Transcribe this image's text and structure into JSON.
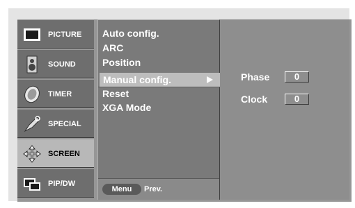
{
  "sidebar": {
    "items": [
      {
        "label": "PICTURE",
        "icon": "picture-icon"
      },
      {
        "label": "SOUND",
        "icon": "speaker-icon"
      },
      {
        "label": "TIMER",
        "icon": "clock-icon"
      },
      {
        "label": "SPECIAL",
        "icon": "pen-icon"
      },
      {
        "label": "SCREEN",
        "icon": "move-arrows-icon",
        "active": true
      },
      {
        "label": "PIP/DW",
        "icon": "pip-icon"
      }
    ]
  },
  "menu": {
    "items": [
      "Auto config.",
      "ARC",
      "Position",
      "Manual config.",
      "Reset",
      "XGA Mode"
    ],
    "selected": "Manual config."
  },
  "footer": {
    "menu_button": "Menu",
    "prev_label": "Prev."
  },
  "manual_config": {
    "params": [
      {
        "label": "Phase",
        "value": "0"
      },
      {
        "label": "Clock",
        "value": "0"
      }
    ]
  },
  "colors": {
    "panel_dark": "#6e6e6e",
    "panel_mid": "#7a7a7a",
    "highlight": "#bdbdbd",
    "background": "#e4e4e4"
  }
}
